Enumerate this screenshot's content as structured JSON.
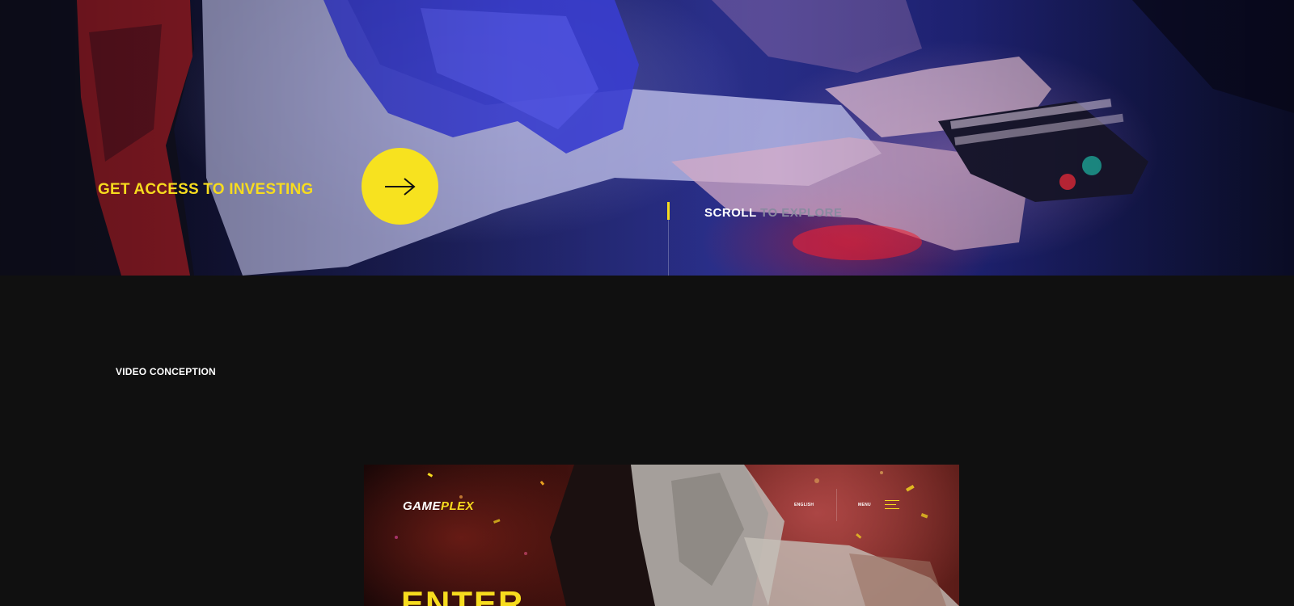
{
  "hero": {
    "cta_text": "GET ACCESS TO INVESTING",
    "cta_button_icon": "arrow-right-icon",
    "scroll_label_white": "SCROLL",
    "scroll_label_gray": "TO EXPLORE"
  },
  "section": {
    "label": "VIDEO CONCEPTION"
  },
  "video": {
    "logo_part1": "GAME",
    "logo_part2": "PLEX",
    "language": "ENGLISH",
    "menu_label": "MENU",
    "menu_icon": "hamburger-menu-icon",
    "headline": "ENTER"
  },
  "colors": {
    "accent": "#f7dc1e",
    "background": "#101010",
    "text": "#ffffff"
  }
}
